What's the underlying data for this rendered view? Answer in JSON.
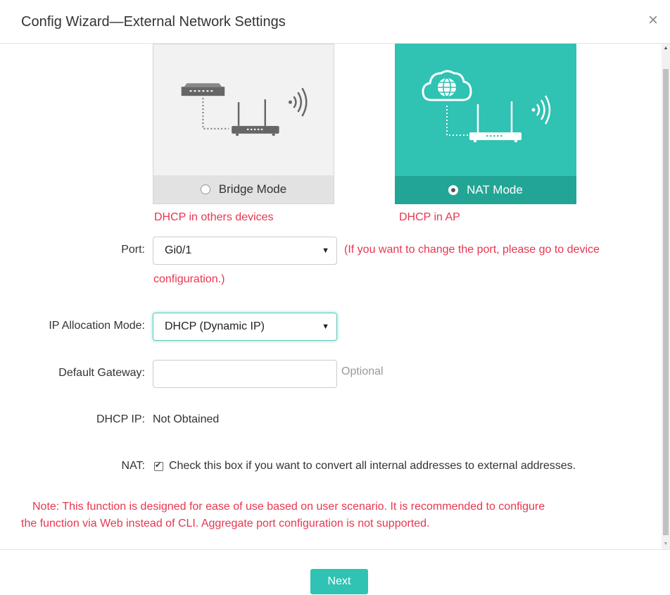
{
  "dialog": {
    "title": "Config Wizard—External Network Settings",
    "close_icon": "close-icon"
  },
  "modes": {
    "bridge": {
      "label": "Bridge Mode",
      "selected": false,
      "description": "DHCP in others devices",
      "icon": "router-switch-icon"
    },
    "nat": {
      "label": "NAT Mode",
      "selected": true,
      "description": "DHCP in AP",
      "icon": "router-cloud-globe-icon"
    }
  },
  "port": {
    "label": "Port:",
    "value": "Gi0/1",
    "note_line1": "(If you want to change the port, please go to device",
    "note_line2": "configuration.)"
  },
  "ip_mode": {
    "label": "IP Allocation Mode:",
    "value": "DHCP (Dynamic IP)"
  },
  "gateway": {
    "label": "Default Gateway:",
    "value": "",
    "hint": "Optional"
  },
  "dhcp_ip": {
    "label": "DHCP IP:",
    "value": "Not Obtained"
  },
  "nat": {
    "label": "NAT:",
    "checked": true,
    "text": "Check this box if you want to convert all internal addresses to external addresses."
  },
  "note": {
    "line1": "Note:  This function is designed for ease of use based on user scenario. It is recommended to configure",
    "line2": "the function via Web instead of CLI. Aggregate port configuration is not supported."
  },
  "footer": {
    "next_label": "Next"
  },
  "colors": {
    "accent": "#30c2b2",
    "accent_dark": "#23a596",
    "warning_red": "#e8364f"
  }
}
